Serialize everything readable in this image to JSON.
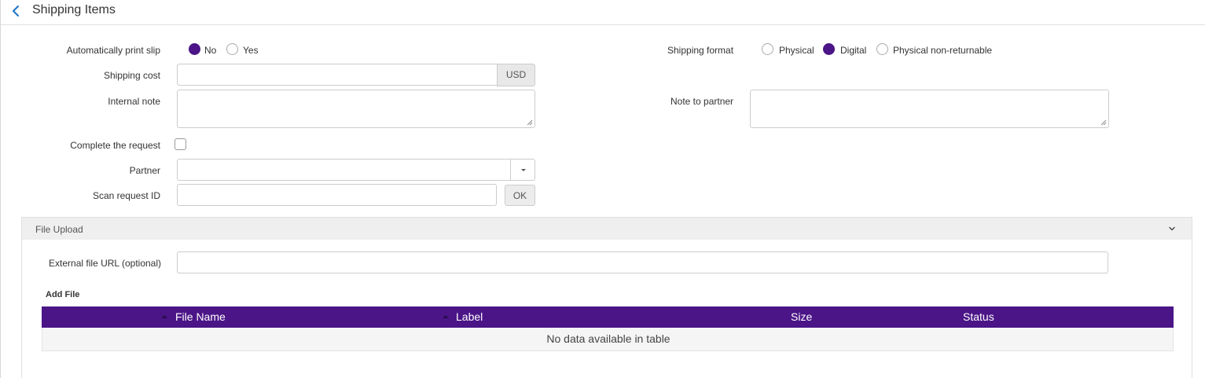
{
  "header": {
    "title": "Shipping Items"
  },
  "form": {
    "auto_print": {
      "label": "Automatically print slip",
      "options": [
        "No",
        "Yes"
      ],
      "selected": "No"
    },
    "shipping_cost": {
      "label": "Shipping cost",
      "value": "",
      "currency": "USD"
    },
    "internal_note": {
      "label": "Internal note",
      "value": ""
    },
    "complete_request": {
      "label": "Complete the request",
      "checked": false
    },
    "partner": {
      "label": "Partner",
      "value": ""
    },
    "scan_request": {
      "label": "Scan request ID",
      "value": "",
      "button": "OK"
    },
    "shipping_format": {
      "label": "Shipping format",
      "options": [
        "Physical",
        "Digital",
        "Physical non-returnable"
      ],
      "selected": "Digital"
    },
    "note_to_partner": {
      "label": "Note to partner",
      "value": ""
    }
  },
  "file_upload": {
    "title": "File Upload",
    "external_url": {
      "label": "External file URL (optional)",
      "value": ""
    },
    "add_file_label": "Add File",
    "table": {
      "columns": [
        "File Name",
        "Label",
        "Size",
        "Status"
      ],
      "empty_message": "No data available in table"
    }
  },
  "colors": {
    "accent": "#4b1587",
    "link": "#1a73c6"
  },
  "icons": {
    "back": "chevron-left-icon",
    "collapse": "chevron-down-icon",
    "dropdown": "caret-down-icon"
  }
}
